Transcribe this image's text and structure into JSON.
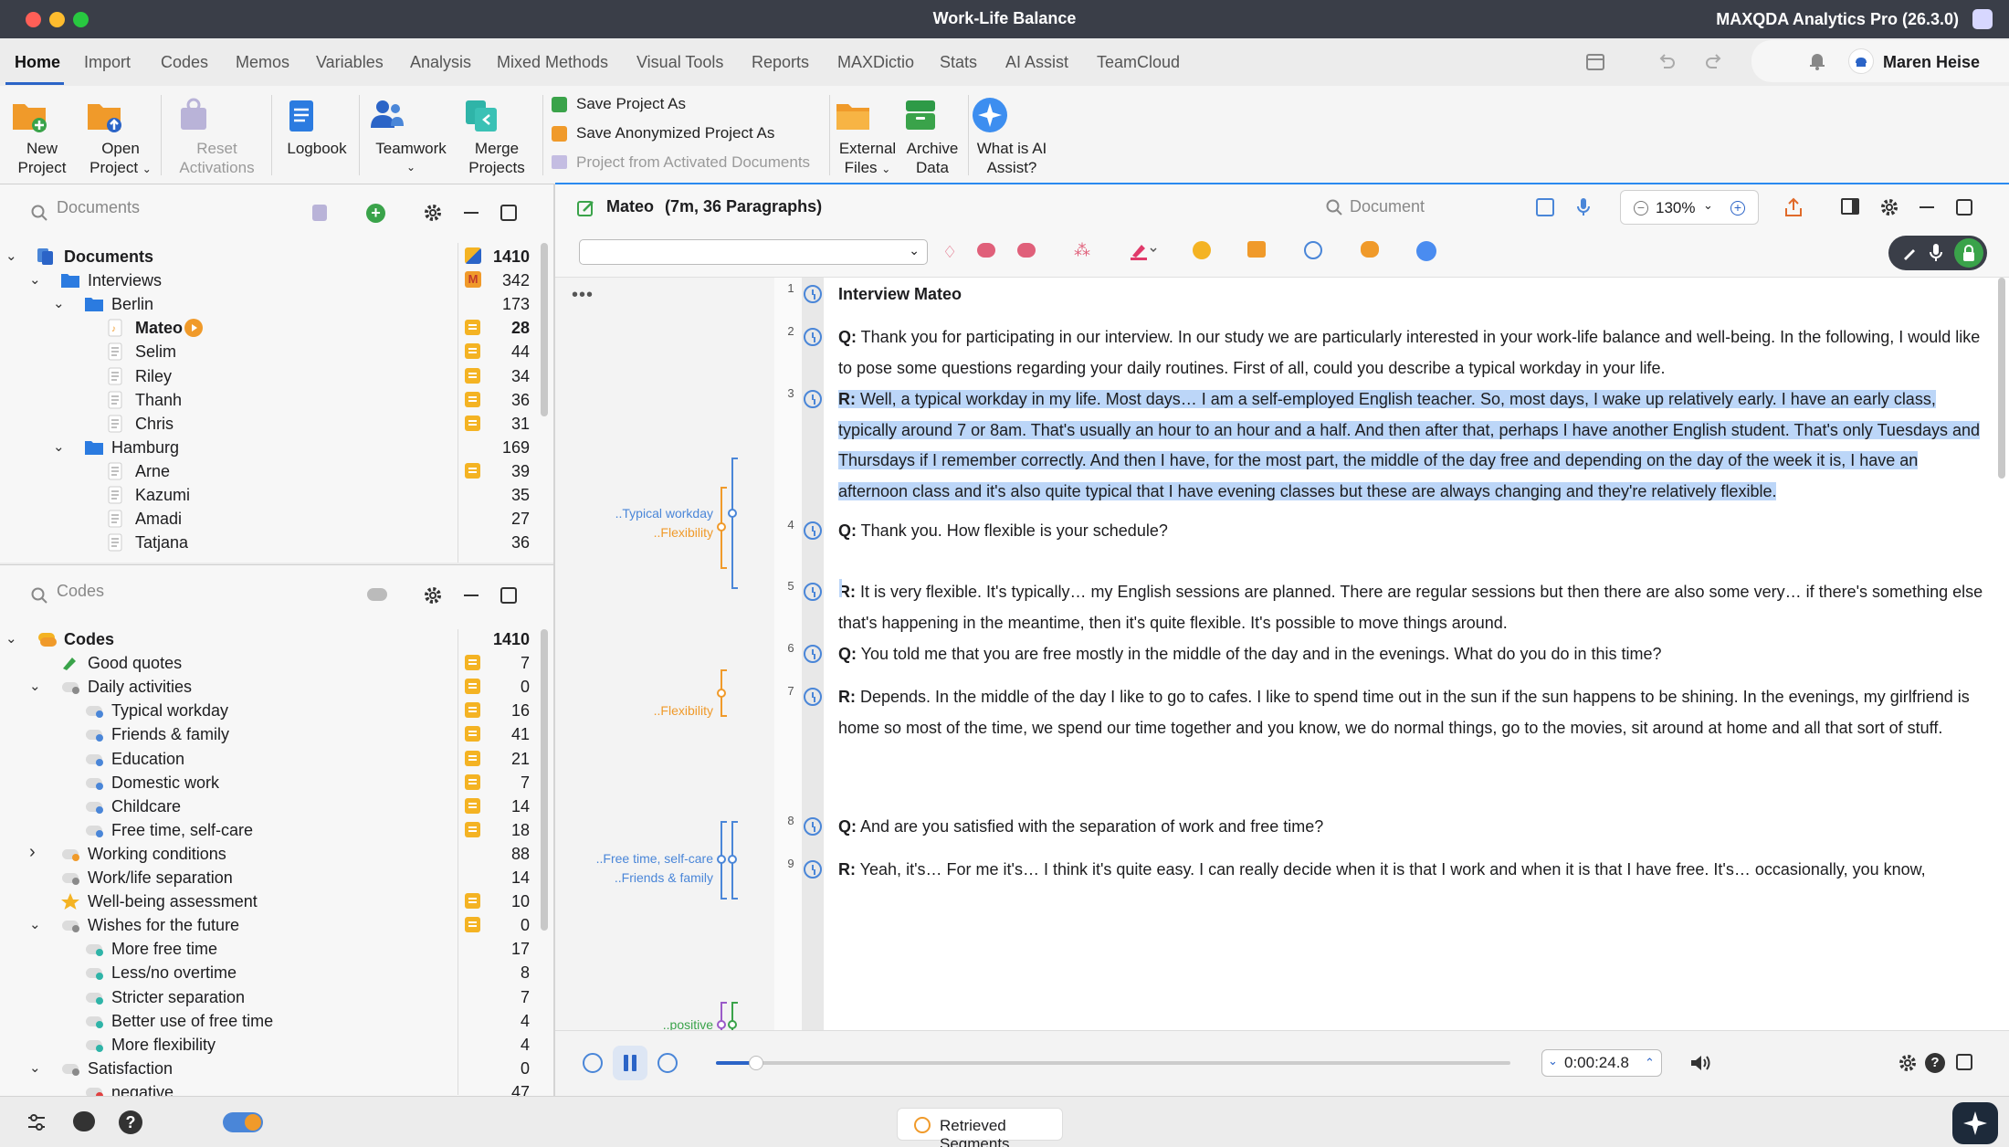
{
  "window": {
    "title": "Work-Life Balance",
    "app_name": "MAXQDA Analytics Pro (26.3.0)"
  },
  "menu": {
    "tabs": [
      "Home",
      "Import",
      "Codes",
      "Memos",
      "Variables",
      "Analysis",
      "Mixed Methods",
      "Visual Tools",
      "Reports",
      "MAXDictio",
      "Stats",
      "AI Assist",
      "TeamCloud"
    ],
    "active": "Home",
    "user": "Maren Heise"
  },
  "ribbon": {
    "new_project": [
      "New",
      "Project"
    ],
    "open_project": [
      "Open",
      "Project"
    ],
    "reset_activations": [
      "Reset",
      "Activations"
    ],
    "logbook": "Logbook",
    "teamwork": "Teamwork",
    "merge_projects": [
      "Merge",
      "Projects"
    ],
    "save_as": "Save Project As",
    "save_anon": "Save Anonymized Project As",
    "from_activated": "Project from Activated Documents",
    "external_files": [
      "External",
      "Files"
    ],
    "archive_data": [
      "Archive",
      "Data"
    ],
    "ai_assist": [
      "What is AI",
      "Assist?"
    ]
  },
  "documents": {
    "search_placeholder": "Documents",
    "rows": [
      {
        "label": "Documents",
        "count": "1410",
        "level": 0,
        "type": "root",
        "bold": true,
        "expanded": true
      },
      {
        "label": "Interviews",
        "count": "342",
        "level": 1,
        "type": "folder",
        "expanded": true,
        "badge": "M"
      },
      {
        "label": "Berlin",
        "count": "173",
        "level": 2,
        "type": "folder",
        "expanded": true
      },
      {
        "label": "Mateo",
        "count": "28",
        "level": 3,
        "type": "audio",
        "bold": true,
        "memo": true,
        "play": true
      },
      {
        "label": "Selim",
        "count": "44",
        "level": 3,
        "type": "doc",
        "memo": true
      },
      {
        "label": "Riley",
        "count": "34",
        "level": 3,
        "type": "doc",
        "memo": true
      },
      {
        "label": "Thanh",
        "count": "36",
        "level": 3,
        "type": "doc",
        "memo": true
      },
      {
        "label": "Chris",
        "count": "31",
        "level": 3,
        "type": "doc",
        "memo": true
      },
      {
        "label": "Hamburg",
        "count": "169",
        "level": 2,
        "type": "folder",
        "expanded": true
      },
      {
        "label": "Arne",
        "count": "39",
        "level": 3,
        "type": "doc",
        "memo": true
      },
      {
        "label": "Kazumi",
        "count": "35",
        "level": 3,
        "type": "doc"
      },
      {
        "label": "Amadi",
        "count": "27",
        "level": 3,
        "type": "doc"
      },
      {
        "label": "Tatjana",
        "count": "36",
        "level": 3,
        "type": "doc"
      }
    ]
  },
  "codes": {
    "search_placeholder": "Codes",
    "rows": [
      {
        "label": "Codes",
        "count": "1410",
        "level": 0,
        "type": "root",
        "bold": true,
        "expanded": true
      },
      {
        "label": "Good quotes",
        "count": "7",
        "level": 1,
        "type": "pen",
        "memo": true,
        "color": "#3aa34a"
      },
      {
        "label": "Daily activities",
        "count": "0",
        "level": 1,
        "type": "code",
        "memo": true,
        "expanded": true,
        "color": "#8a8a8a"
      },
      {
        "label": "Typical workday",
        "count": "16",
        "level": 2,
        "type": "code",
        "memo": true,
        "color": "#4a86d8"
      },
      {
        "label": "Friends & family",
        "count": "41",
        "level": 2,
        "type": "code",
        "memo": true,
        "color": "#4a86d8"
      },
      {
        "label": "Education",
        "count": "21",
        "level": 2,
        "type": "code",
        "memo": true,
        "color": "#4a86d8"
      },
      {
        "label": "Domestic work",
        "count": "7",
        "level": 2,
        "type": "code",
        "memo": true,
        "color": "#4a86d8"
      },
      {
        "label": "Childcare",
        "count": "14",
        "level": 2,
        "type": "code",
        "memo": true,
        "color": "#4a86d8"
      },
      {
        "label": "Free time, self-care",
        "count": "18",
        "level": 2,
        "type": "code",
        "memo": true,
        "color": "#4a86d8"
      },
      {
        "label": "Working conditions",
        "count": "88",
        "level": 1,
        "type": "code",
        "collapsed": true,
        "color": "#f09a2a"
      },
      {
        "label": "Work/life separation",
        "count": "14",
        "level": 1,
        "type": "code",
        "color": "#8a8a8a"
      },
      {
        "label": "Well-being assessment",
        "count": "10",
        "level": 1,
        "type": "star",
        "memo": true,
        "color": "#f4b323"
      },
      {
        "label": "Wishes for the future",
        "count": "0",
        "level": 1,
        "type": "code",
        "memo": true,
        "expanded": true,
        "color": "#8a8a8a"
      },
      {
        "label": "More free time",
        "count": "17",
        "level": 2,
        "type": "code",
        "color": "#2fb4a8"
      },
      {
        "label": "Less/no overtime",
        "count": "8",
        "level": 2,
        "type": "code",
        "color": "#2fb4a8"
      },
      {
        "label": "Stricter separation",
        "count": "7",
        "level": 2,
        "type": "code",
        "color": "#2fb4a8"
      },
      {
        "label": "Better use of free time",
        "count": "4",
        "level": 2,
        "type": "code",
        "color": "#2fb4a8"
      },
      {
        "label": "More flexibility",
        "count": "4",
        "level": 2,
        "type": "code",
        "color": "#2fb4a8"
      },
      {
        "label": "Satisfaction",
        "count": "0",
        "level": 1,
        "type": "code",
        "expanded": true,
        "color": "#8a8a8a"
      },
      {
        "label": "negative",
        "count": "47",
        "level": 2,
        "type": "code",
        "color": "#e04040"
      }
    ]
  },
  "document_browser": {
    "title": "Mateo",
    "meta": "(7m, 36 Paragraphs)",
    "search_placeholder": "Document",
    "zoom": "130%",
    "paragraphs": [
      {
        "n": "1",
        "bold": "Interview Mateo",
        "text": ""
      },
      {
        "n": "2",
        "bold": "Q:",
        "text": " Thank you for participating in our interview. In our study we are particularly interested in your work-life balance and well-being. In the following, I would like to pose some questions regarding your daily routines. First of all, could you describe a typical workday in your life."
      },
      {
        "n": "3",
        "bold": "R:",
        "text": " Well, a typical workday in my life. Most days… I am a self-employed English teacher. So, most days, I wake up relatively early. I have an early class, typically around 7 or 8am. That's usually an hour to an hour and a half. And then after that, perhaps I have another English student. That's only Tuesdays and Thursdays if I remember correctly. And then I have, for the most part, the middle of the day free and depending on the day of the week it is, I have an afternoon class and it's also quite typical that I have evening classes but these are always changing and they're relatively flexible."
      },
      {
        "n": "4",
        "bold": "Q:",
        "text": " Thank you. How flexible is your schedule?"
      },
      {
        "n": "5",
        "bold": "R:",
        "text": " It is very flexible. It's typically… my English sessions are planned. There are regular sessions but then there are also some very… if there's something else that's happening in the meantime, then it's quite flexible. It's possible to move things around."
      },
      {
        "n": "6",
        "bold": "Q:",
        "text": " You told me that you are free mostly in the middle of the day and in the evenings. What do you do in this time?"
      },
      {
        "n": "7",
        "bold": "R:",
        "text": " Depends. In the middle of the day I like to go to cafes. I like to spend time out in the sun if the sun happens to be shining. In the evenings, my girlfriend is home so most of the time, we spend our time together and you know, we do normal things, go to the movies, sit around at home and all that sort of stuff."
      },
      {
        "n": "8",
        "bold": "Q:",
        "text": " And are you satisfied with the separation of work and free time?"
      },
      {
        "n": "9",
        "bold": "R:",
        "text": " Yeah, it's… For me it's… I think it's quite easy. I can really decide when it is that I work and when it is that I have free. It's… occasionally, you know,"
      }
    ],
    "coding_labels": [
      {
        "text": "..Typical workday",
        "color": "#4a86d8",
        "para": "3"
      },
      {
        "text": "..Flexibility",
        "color": "#f09a2a",
        "para": "3"
      },
      {
        "text": "..Flexibility",
        "color": "#f09a2a",
        "para": "5"
      },
      {
        "text": "..Free time, self-care",
        "color": "#4a86d8",
        "para": "7"
      },
      {
        "text": "..Friends & family",
        "color": "#4a86d8",
        "para": "7"
      },
      {
        "text": "..positive",
        "color": "#3aa34a",
        "para": "9"
      }
    ]
  },
  "player": {
    "time": "0:00:24.8",
    "progress": 0.05
  },
  "status": {
    "retrieved_segments": "Retrieved Segments"
  }
}
